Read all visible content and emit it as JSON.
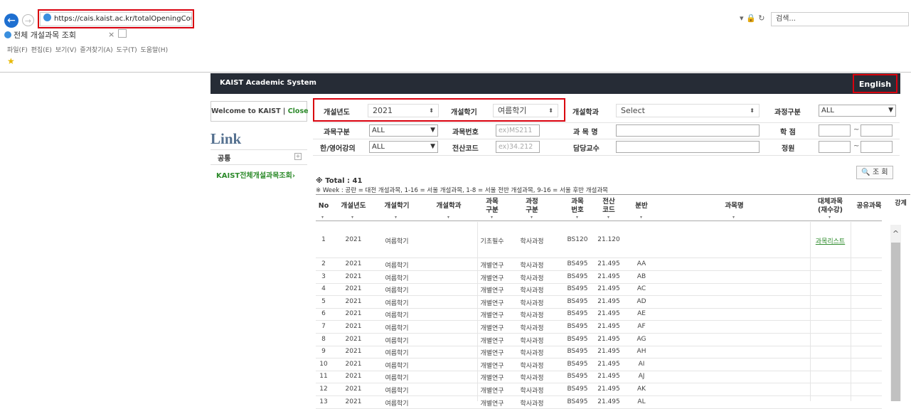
{
  "browser": {
    "url": "https://cais.kaist.ac.kr/totalOpeningCourse",
    "tab_title": "전체 개설과목 조회",
    "tab_close": "×",
    "search_placeholder": "검색...",
    "menu": "파일(F)  편집(E)  보기(V)  즐겨찾기(A)  도구(T)  도움말(H)"
  },
  "header": {
    "brand": "KAIST Academic System",
    "english": "English"
  },
  "sidebar": {
    "welcome": "Welcome to KAIST",
    "sep": " | ",
    "close": "Close",
    "link_title": "Link",
    "common": "공통",
    "plus": "⊞",
    "kaist_link": "KAIST전체개설과목조회›"
  },
  "filters": {
    "year_label": "개설년도",
    "year_value": "2021",
    "term_label": "개설학기",
    "term_value": "여름학기",
    "dept_label": "개설학과",
    "dept_value": "Select",
    "program_label": "과정구분",
    "program_value": "ALL",
    "subject_type_label": "과목구분",
    "subject_type_value": "ALL",
    "course_no_label": "과목번호",
    "course_no_placeholder": "ex)MS211",
    "course_name_label": "과 목 명",
    "credit_label": "학 점",
    "lang_label": "한/영어강의",
    "lang_value": "ALL",
    "code_label": "전산코드",
    "code_placeholder": "ex)34.212",
    "prof_label": "담당교수",
    "capacity_label": "정원",
    "tilde": "~",
    "search_button": "조 회"
  },
  "results": {
    "total": "※ Total : 41",
    "week_note": "※ Week : 공란 = 대전 개설과목, 1-16 = 서울 개설과목, 1-8 = 서울 전반 개설과목, 9-16 = 서울 후반 개설과목"
  },
  "table": {
    "headers": {
      "no": "No",
      "year": "개설년도",
      "term": "개설학기",
      "dept": "개설학과",
      "subject_type_1": "과목",
      "subject_type_2": "구분",
      "program_1": "과정",
      "program_2": "구분",
      "course_no_1": "과목",
      "course_no_2": "번호",
      "code_1": "전산",
      "code_2": "코드",
      "section": "분반",
      "name": "과목명",
      "substitute_1": "대체과목",
      "substitute_2": "(재수강)",
      "shared": "공유과목",
      "extra": "강계"
    },
    "sort_mark": "▾",
    "substitute_link": "과목리스트",
    "rows": [
      {
        "no": "1",
        "year": "2021",
        "term": "여름학기",
        "type": "기초필수",
        "program": "학사과정",
        "course": "BS120",
        "code": "21.120",
        "section": ""
      },
      {
        "no": "2",
        "year": "2021",
        "term": "여름학기",
        "type": "개별연구",
        "program": "학사과정",
        "course": "BS495",
        "code": "21.495",
        "section": "AA"
      },
      {
        "no": "3",
        "year": "2021",
        "term": "여름학기",
        "type": "개별연구",
        "program": "학사과정",
        "course": "BS495",
        "code": "21.495",
        "section": "AB"
      },
      {
        "no": "4",
        "year": "2021",
        "term": "여름학기",
        "type": "개별연구",
        "program": "학사과정",
        "course": "BS495",
        "code": "21.495",
        "section": "AC"
      },
      {
        "no": "5",
        "year": "2021",
        "term": "여름학기",
        "type": "개별연구",
        "program": "학사과정",
        "course": "BS495",
        "code": "21.495",
        "section": "AD"
      },
      {
        "no": "6",
        "year": "2021",
        "term": "여름학기",
        "type": "개별연구",
        "program": "학사과정",
        "course": "BS495",
        "code": "21.495",
        "section": "AE"
      },
      {
        "no": "7",
        "year": "2021",
        "term": "여름학기",
        "type": "개별연구",
        "program": "학사과정",
        "course": "BS495",
        "code": "21.495",
        "section": "AF"
      },
      {
        "no": "8",
        "year": "2021",
        "term": "여름학기",
        "type": "개별연구",
        "program": "학사과정",
        "course": "BS495",
        "code": "21.495",
        "section": "AG"
      },
      {
        "no": "9",
        "year": "2021",
        "term": "여름학기",
        "type": "개별연구",
        "program": "학사과정",
        "course": "BS495",
        "code": "21.495",
        "section": "AH"
      },
      {
        "no": "10",
        "year": "2021",
        "term": "여름학기",
        "type": "개별연구",
        "program": "학사과정",
        "course": "BS495",
        "code": "21.495",
        "section": "AI"
      },
      {
        "no": "11",
        "year": "2021",
        "term": "여름학기",
        "type": "개별연구",
        "program": "학사과정",
        "course": "BS495",
        "code": "21.495",
        "section": "AJ"
      },
      {
        "no": "12",
        "year": "2021",
        "term": "여름학기",
        "type": "개별연구",
        "program": "학사과정",
        "course": "BS495",
        "code": "21.495",
        "section": "AK"
      },
      {
        "no": "13",
        "year": "2021",
        "term": "여름학기",
        "type": "개별연구",
        "program": "학사과정",
        "course": "BS495",
        "code": "21.495",
        "section": "AL"
      }
    ]
  }
}
